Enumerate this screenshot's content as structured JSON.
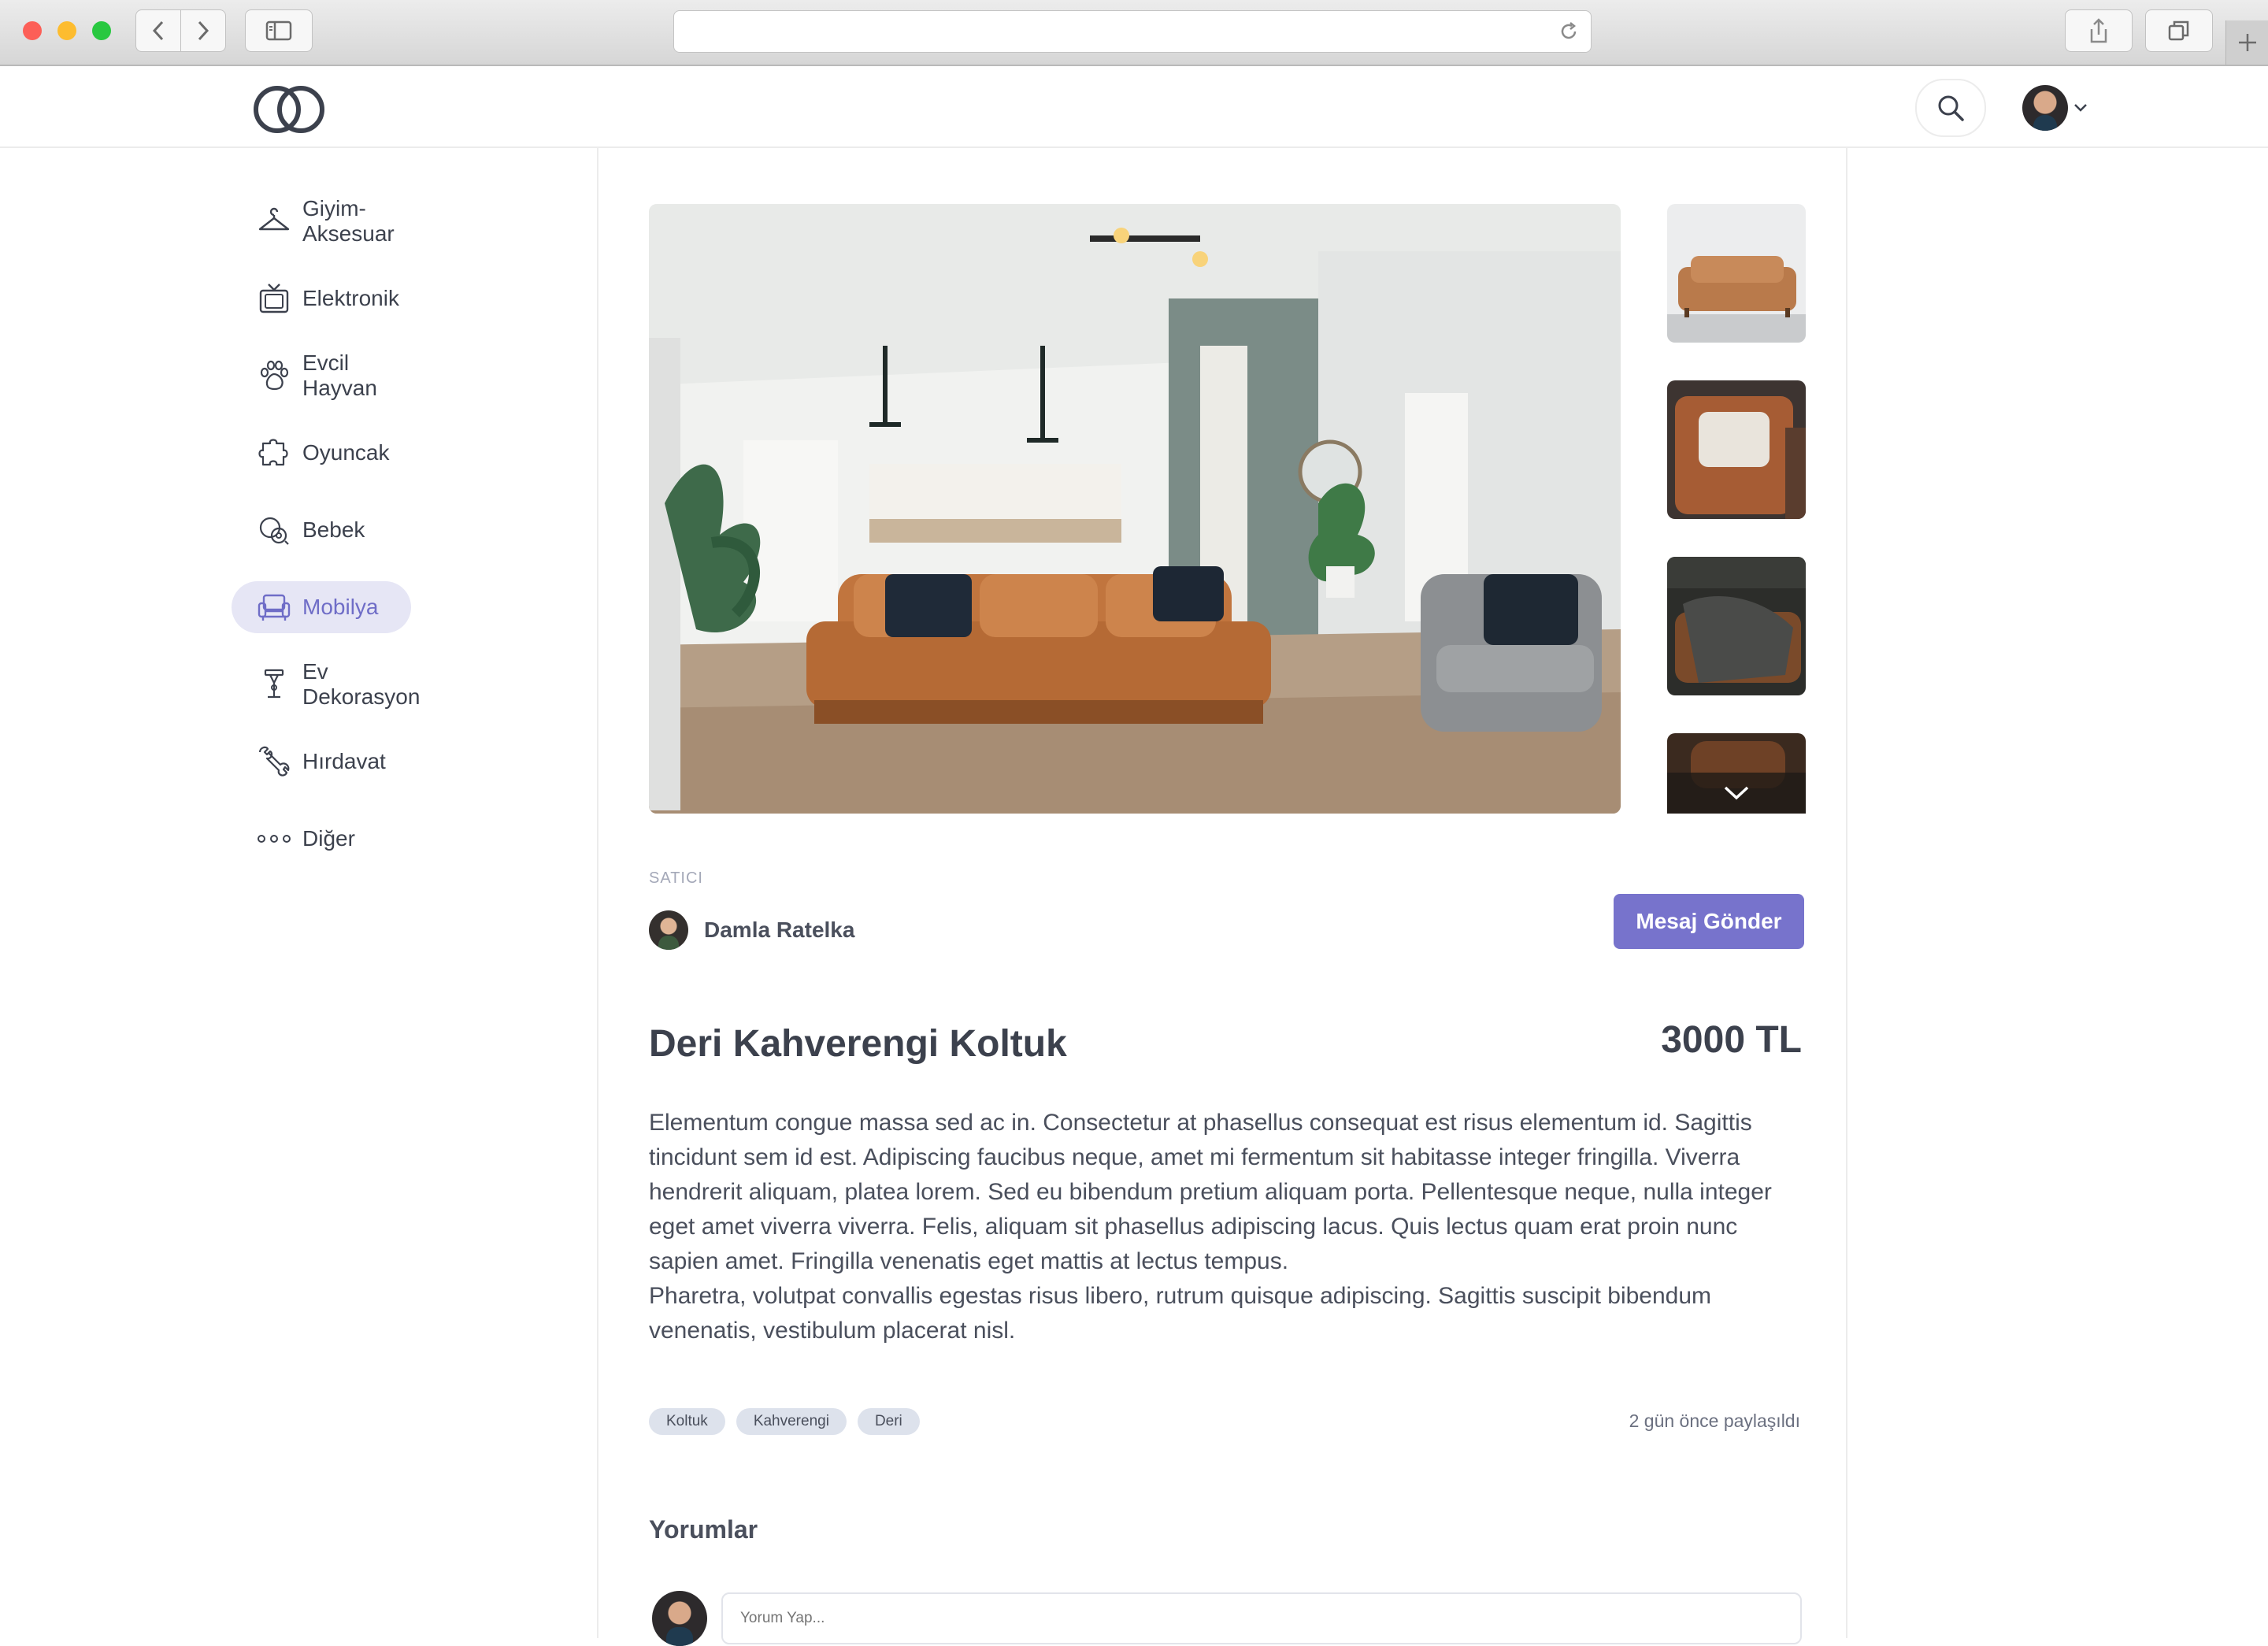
{
  "header": {
    "logo_name": "intertwined-rings-logo",
    "search_icon": "search-icon",
    "avatar_menu_icon": "chevron-down-icon"
  },
  "sidebar": {
    "items": [
      {
        "label": "Giyim-Aksesuar",
        "icon": "hanger-icon"
      },
      {
        "label": "Elektronik",
        "icon": "tv-icon"
      },
      {
        "label": "Evcil Hayvan",
        "icon": "paw-icon"
      },
      {
        "label": "Oyuncak",
        "icon": "puzzle-icon"
      },
      {
        "label": "Bebek",
        "icon": "baby-icon"
      },
      {
        "label": "Mobilya",
        "icon": "armchair-icon",
        "active": true
      },
      {
        "label": "Ev Dekorasyon",
        "icon": "lamp-icon"
      },
      {
        "label": "Hırdavat",
        "icon": "wrench-icon"
      },
      {
        "label": "Diğer",
        "icon": "dots-icon"
      }
    ]
  },
  "product": {
    "seller_label": "SATICI",
    "seller_name": "Damla Ratelka",
    "message_button": "Mesaj Gönder",
    "title": "Deri Kahverengi Koltuk",
    "price": "3000 TL",
    "description": [
      "Elementum congue massa sed ac in. Consectetur at phasellus consequat est risus elementum id. Sagittis tincidunt sem id est. Adipiscing faucibus neque, amet mi fermentum sit habitasse integer fringilla. Viverra hendrerit aliquam, platea lorem. Sed eu bibendum pretium aliquam porta. Pellentesque neque, nulla integer eget amet viverra viverra. Felis, aliquam sit phasellus adipiscing lacus. Quis lectus quam erat proin nunc sapien amet. Fringilla venenatis eget mattis at lectus tempus.",
      "Pharetra, volutpat convallis egestas risus libero, rutrum quisque adipiscing. Sagittis suscipit bibendum venenatis, vestibulum placerat nisl."
    ],
    "tags": [
      "Koltuk",
      "Kahverengi",
      "Deri"
    ],
    "shared": "2 gün önce paylaşıldı"
  },
  "comments": {
    "title": "Yorumlar",
    "placeholder": "Yorum Yap..."
  },
  "colors": {
    "accent": "#7773cc",
    "active_bg": "#e6e6f5",
    "tag_bg": "#dde2ec"
  }
}
